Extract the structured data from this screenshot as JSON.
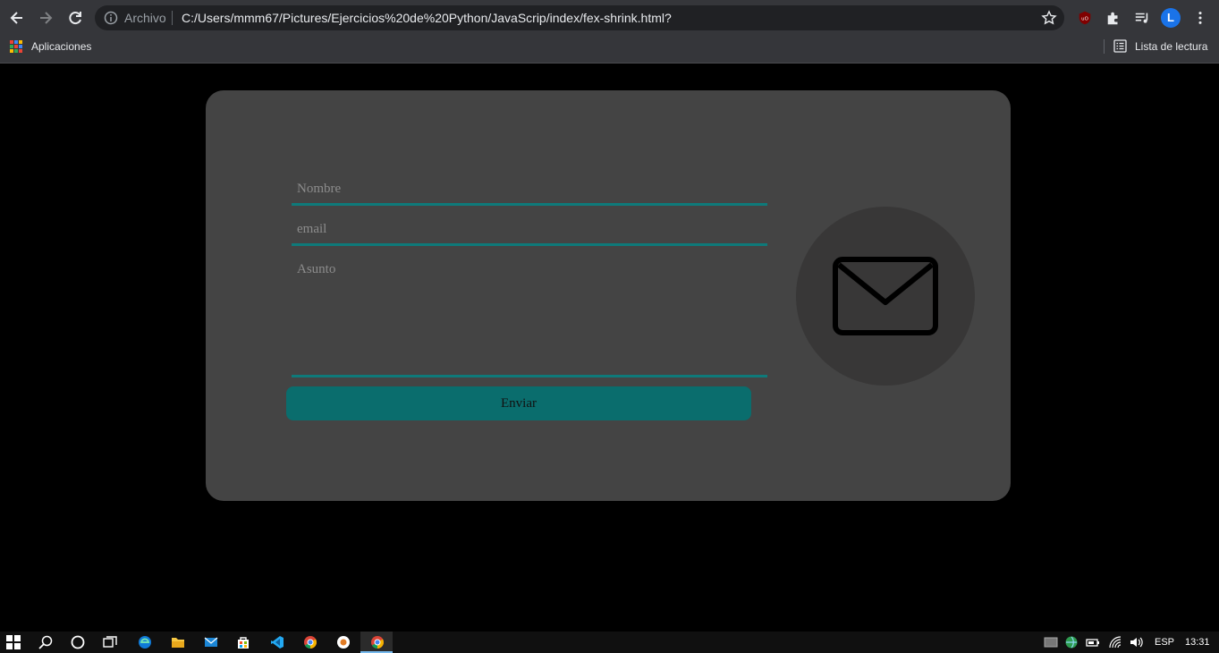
{
  "browser": {
    "archivo_label": "Archivo",
    "url": "C:/Users/mmm67/Pictures/Ejercicios%20de%20Python/JavaScrip/index/fex-shrink.html?",
    "profile_initial": "L",
    "bookmarks": {
      "apps_label": "Aplicaciones",
      "reading_list_label": "Lista de lectura"
    }
  },
  "form": {
    "name_placeholder": "Nombre",
    "email_placeholder": "email",
    "subject_placeholder": "Asunto",
    "submit_label": "Enviar"
  },
  "taskbar": {
    "language": "ESP",
    "time": "13:31"
  },
  "colors": {
    "accent": "#0a6d6d",
    "card": "#444444",
    "page_bg": "#000000"
  }
}
